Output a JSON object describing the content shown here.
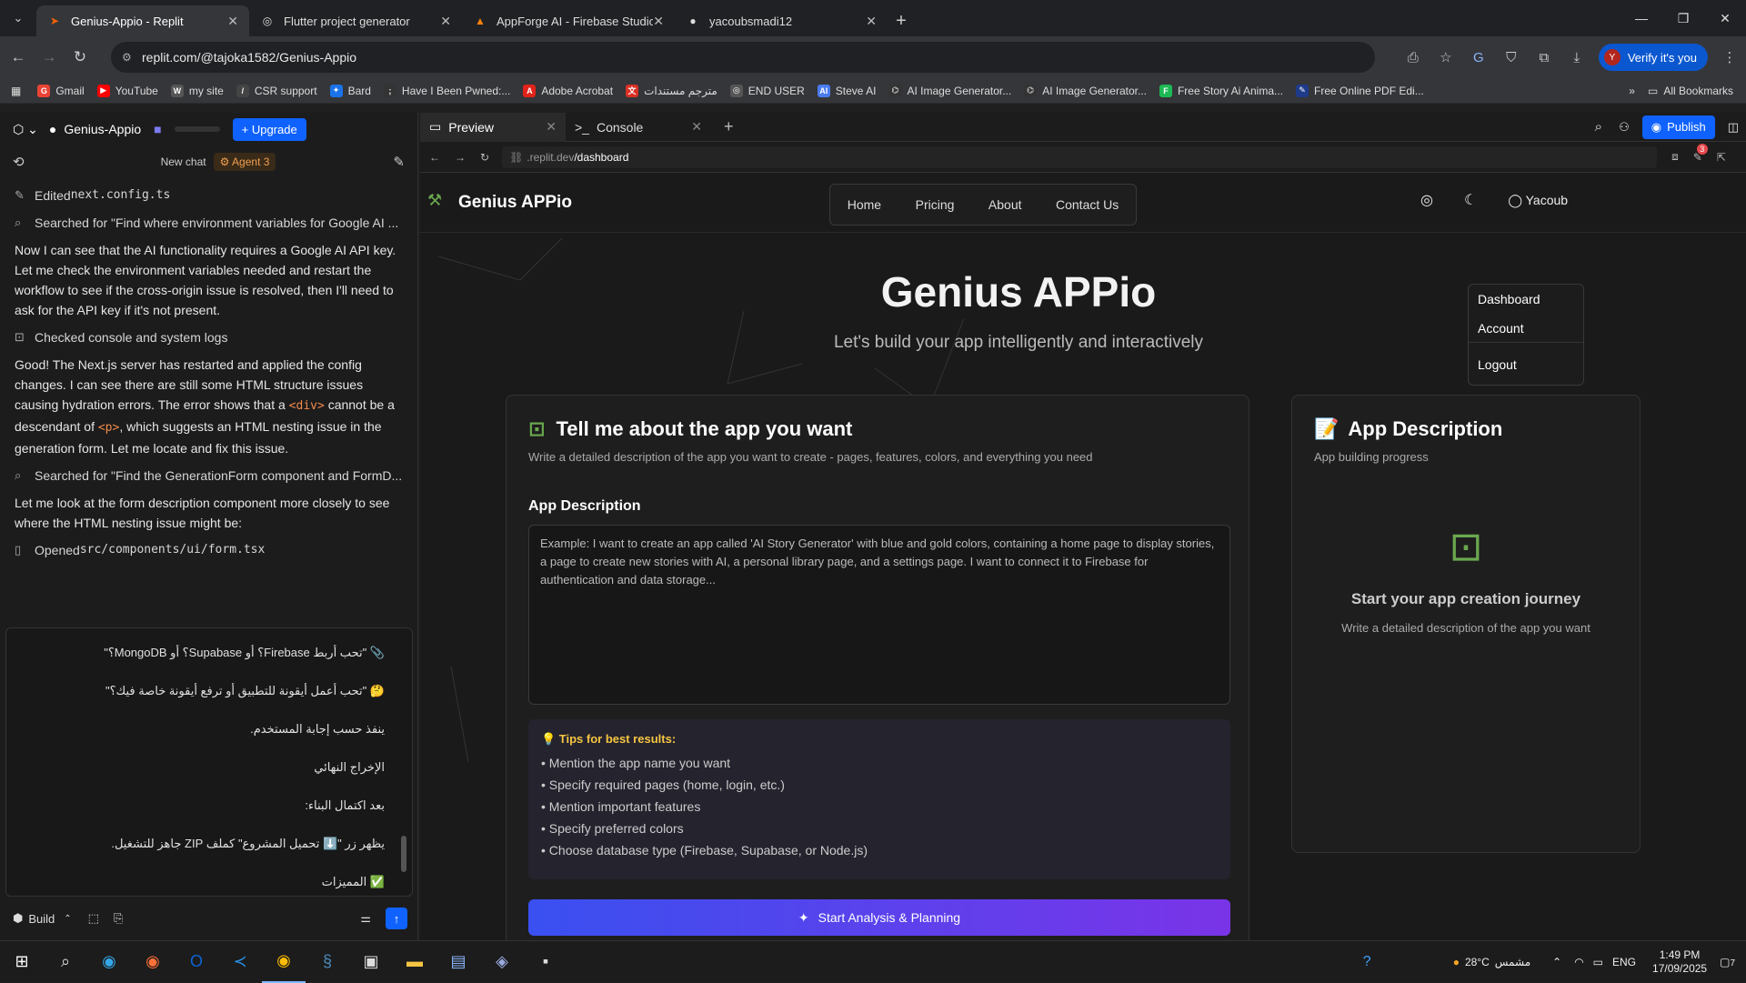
{
  "browser": {
    "tabs": [
      {
        "title": "Genius-Appio - Replit",
        "active": true,
        "icon": "replit-icon"
      },
      {
        "title": "Flutter project generator",
        "active": false,
        "icon": "globe-icon"
      },
      {
        "title": "AppForge AI - Firebase Studio",
        "active": false,
        "icon": "firebase-icon"
      },
      {
        "title": "yacoubsmadi12",
        "active": false,
        "icon": "github-icon"
      }
    ],
    "url": "replit.com/@tajoka1582/Genius-Appio",
    "verify_label": "Verify it's you",
    "bookmarks": [
      "Gmail",
      "YouTube",
      "my site",
      "CSR support",
      "Bard",
      "Have I Been Pwned:...",
      "Adobe Acrobat",
      "مترجم مستندات",
      "END USER",
      "Steve AI",
      "AI Image Generator...",
      "AI Image Generator...",
      "Free Story Ai Anima...",
      "Free Online PDF Edi..."
    ],
    "all_bookmarks": "All Bookmarks"
  },
  "workspace": {
    "project_name": "Genius-Appio",
    "upgrade_label": "Upgrade",
    "new_chat": "New chat",
    "agent_label": "Agent 3",
    "messages": [
      {
        "type": "action",
        "icon": "edit-icon",
        "text": "Edited ",
        "code": "next.config.ts"
      },
      {
        "type": "action",
        "icon": "search-icon",
        "text": "Searched for \"Find where environment variables for Google AI ..."
      },
      {
        "type": "text",
        "text": "Now I can see that the AI functionality requires a Google AI API key. Let me check the environment variables needed and restart the workflow to see if the cross-origin issue is resolved, then I'll need to ask for the API key if it's not present."
      },
      {
        "type": "action",
        "icon": "terminal-icon",
        "text": "Checked console and system logs"
      },
      {
        "type": "text_rich",
        "p1": "Good! The Next.js server has restarted and applied the config changes. I can see there are still some HTML structure issues causing hydration errors. The error shows that a ",
        "c1": "<div>",
        "p2": " cannot be a descendant of ",
        "c2": "<p>",
        "p3": ", which suggests an HTML nesting issue in the generation form. Let me locate and fix this issue."
      },
      {
        "type": "action",
        "icon": "search-icon",
        "text": "Searched for \"Find the GenerationForm component and FormD..."
      },
      {
        "type": "text",
        "text": "Let me look at the form description component more closely to see where the HTML nesting issue might be:"
      },
      {
        "type": "action",
        "icon": "book-icon",
        "text": "Opened ",
        "code": "src/components/ui/form.tsx"
      }
    ],
    "input_lines": [
      "📎 \"تحب أربط Firebase؟ أو Supabase؟ أو MongoDB؟\"",
      "🤔 \"تحب أعمل أيقونة للتطبيق أو ترفع أيقونة خاصة فيك؟\"",
      "ينفذ حسب إجابة المستخدم.",
      "الإخراج النهائي",
      "بعد اكتمال البناء:",
      "يظهر زر \"⬇️ تحميل المشروع\" كملف ZIP جاهز للتشغيل.",
      "✅ المميزات"
    ],
    "build_label": "Build"
  },
  "preview": {
    "tabs": [
      "Preview",
      "Console"
    ],
    "url_prefix": ".replit.dev",
    "url_path": "/dashboard",
    "publish_label": "Publish",
    "badge_count": "3"
  },
  "site": {
    "brand": "Genius APPio",
    "nav": [
      "Home",
      "Pricing",
      "About",
      "Contact Us"
    ],
    "user": "Yacoub",
    "dropdown": [
      "Dashboard",
      "Account",
      "Logout"
    ],
    "hero_title": "Genius APPio",
    "hero_subtitle": "Let's build your app intelligently and interactively",
    "form_card": {
      "title": "Tell me about the app you want",
      "subtitle": "Write a detailed description of the app you want to create - pages, features, colors, and everything you need",
      "field_label": "App Description",
      "placeholder": "Example: I want to create an app called 'AI Story Generator' with blue and gold colors, containing a home page to display stories, a page to create new stories with AI, a personal library page, and a settings page. I want to connect it to Firebase for authentication and data storage...",
      "tips_title": "💡 Tips for best results:",
      "tips": [
        "• Mention the app name you want",
        "• Specify required pages (home, login, etc.)",
        "• Mention important features",
        "• Specify preferred colors",
        "• Choose database type (Firebase, Supabase, or Node.js)"
      ],
      "button": "Start Analysis & Planning"
    },
    "desc_card": {
      "title": "App Description",
      "subtitle": "App building progress",
      "empty_title": "Start your app creation journey",
      "empty_text": "Write a detailed description of the app you want"
    }
  },
  "taskbar": {
    "weather": "28°C",
    "weather_desc": "مشمس",
    "lang": "ENG",
    "time": "1:49 PM",
    "date": "17/09/2025",
    "notif": "7"
  }
}
